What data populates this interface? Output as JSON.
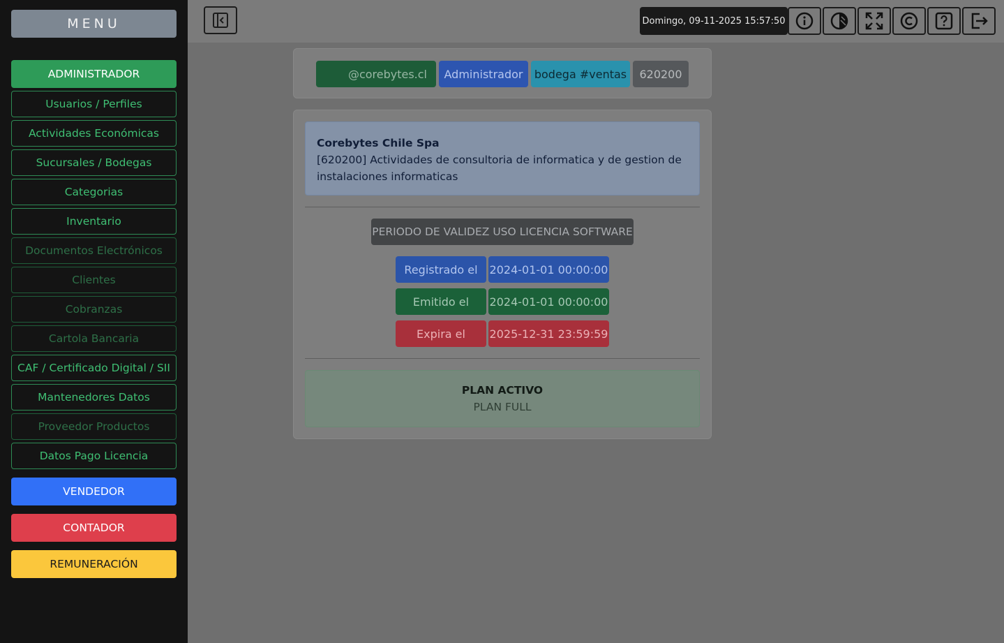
{
  "sidebar": {
    "title": "MENU",
    "admin": "ADMINISTRADOR",
    "items": [
      {
        "label": "Usuarios / Perfiles"
      },
      {
        "label": "Actividades Económicas"
      },
      {
        "label": "Sucursales / Bodegas"
      },
      {
        "label": "Categorias"
      },
      {
        "label": "Inventario"
      },
      {
        "label": "Documentos Electrónicos"
      },
      {
        "label": "Clientes"
      },
      {
        "label": "Cobranzas"
      },
      {
        "label": "Cartola Bancaria"
      },
      {
        "label": "CAF / Certificado Digital / SII"
      },
      {
        "label": "Mantenedores Datos"
      },
      {
        "label": "Proveedor Productos"
      },
      {
        "label": "Datos Pago Licencia"
      }
    ],
    "vendedor": "VENDEDOR",
    "contador": "CONTADOR",
    "remuneracion": "REMUNERACIÓN"
  },
  "topbar": {
    "datetime": "Domingo, 09-11-2025 15:57:50",
    "icons": [
      "info-icon",
      "theme-icon",
      "fullscreen-icon",
      "copyright-icon",
      "help-icon",
      "logout-icon"
    ]
  },
  "user": {
    "email": "@corebytes.cl",
    "role": "Administrador",
    "bodega": "bodega #ventas",
    "code": "620200"
  },
  "company": {
    "name": "Corebytes Chile Spa",
    "activity": "[620200] Actividades de consultoria de informatica y de gestion de instalaciones informaticas"
  },
  "license": {
    "title": "PERIODO DE VALIDEZ USO LICENCIA SOFTWARE",
    "registered_label": "Registrado el",
    "registered_value": "2024-01-01 00:00:00",
    "issued_label": "Emitido el",
    "issued_value": "2024-01-01 00:00:00",
    "expires_label": "Expira el",
    "expires_value": "2025-12-31 23:59:59"
  },
  "plan": {
    "title": "PLAN ACTIVO",
    "value": "PLAN FULL"
  },
  "colors": {
    "admin": "#2e9b58",
    "vendedor": "#3170f7",
    "contador": "#de3f4c",
    "remuneracion": "#fbc73c"
  }
}
